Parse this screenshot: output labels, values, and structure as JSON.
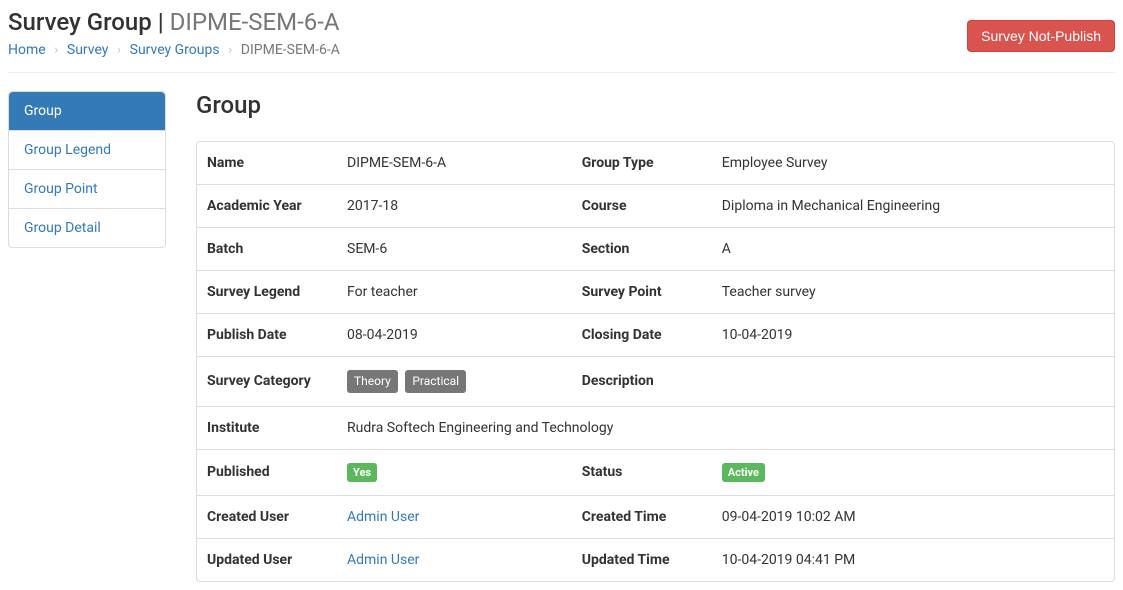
{
  "header": {
    "title_prefix": "Survey Group",
    "title_sep": " | ",
    "title_sub": "DIPME-SEM-6-A",
    "action_button": "Survey Not-Publish"
  },
  "breadcrumb": {
    "home": "Home",
    "survey": "Survey",
    "groups": "Survey Groups",
    "current": "DIPME-SEM-6-A"
  },
  "sidebar": {
    "items": [
      {
        "label": "Group",
        "active": true
      },
      {
        "label": "Group Legend",
        "active": false
      },
      {
        "label": "Group Point",
        "active": false
      },
      {
        "label": "Group Detail",
        "active": false
      }
    ]
  },
  "section_title": "Group",
  "detail": {
    "name": "DIPME-SEM-6-A",
    "group_type": "Employee Survey",
    "academic_year": "2017-18",
    "course": "Diploma in Mechanical Engineering",
    "batch": "SEM-6",
    "section": "A",
    "survey_legend": "For teacher",
    "survey_point": "Teacher survey",
    "publish_date": "08-04-2019",
    "closing_date": "10-04-2019",
    "category1": "Theory",
    "category2": "Practical",
    "description": "",
    "institute": "Rudra Softech Engineering and Technology",
    "published": "Yes",
    "status": "Active",
    "created_user": "Admin User",
    "created_time": "09-04-2019 10:02 AM",
    "updated_user": "Admin User",
    "updated_time": "10-04-2019 04:41 PM"
  },
  "labels": {
    "name": "Name",
    "group_type": "Group Type",
    "academic_year": "Academic Year",
    "course": "Course",
    "batch": "Batch",
    "section": "Section",
    "survey_legend": "Survey Legend",
    "survey_point": "Survey Point",
    "publish_date": "Publish Date",
    "closing_date": "Closing Date",
    "survey_category": "Survey Category",
    "description": "Description",
    "institute": "Institute",
    "published": "Published",
    "status": "Status",
    "created_user": "Created User",
    "created_time": "Created Time",
    "updated_user": "Updated User",
    "updated_time": "Updated Time"
  }
}
